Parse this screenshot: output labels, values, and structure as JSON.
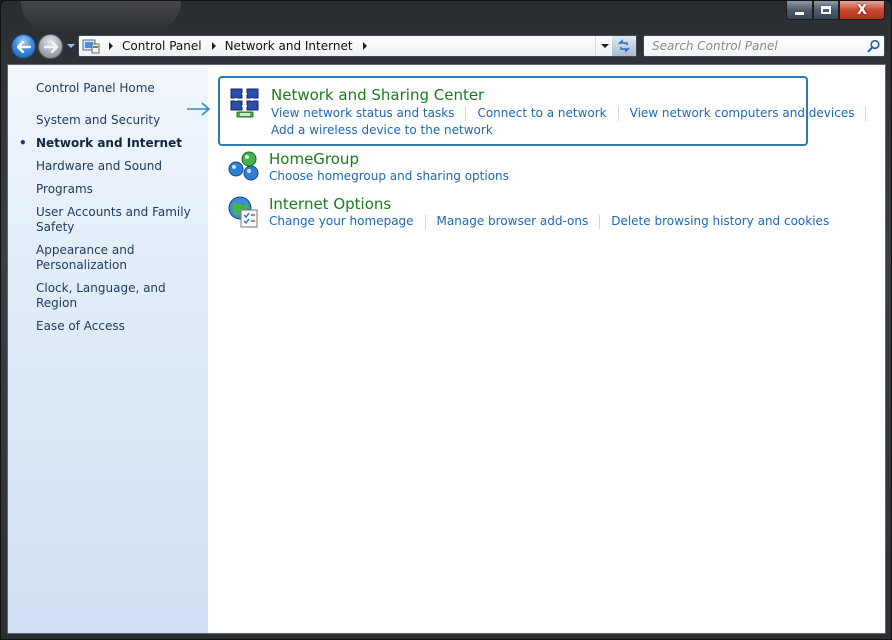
{
  "window": {
    "caption": {
      "minimize_icon": "minimize-icon",
      "maximize_icon": "maximize-icon",
      "close_icon": "close-icon",
      "close_glyph": "X"
    }
  },
  "nav": {
    "back_icon": "back-arrow-icon",
    "forward_icon": "forward-arrow-icon",
    "breadcrumbs": [
      "Control Panel",
      "Network and Internet"
    ],
    "search_placeholder": "Search Control Panel",
    "refresh_icon": "refresh-icon"
  },
  "sidebar": {
    "home": "Control Panel Home",
    "items": [
      {
        "label": "System and Security",
        "active": false
      },
      {
        "label": "Network and Internet",
        "active": true
      },
      {
        "label": "Hardware and Sound",
        "active": false
      },
      {
        "label": "Programs",
        "active": false
      },
      {
        "label": "User Accounts and Family Safety",
        "active": false
      },
      {
        "label": "Appearance and Personalization",
        "active": false
      },
      {
        "label": "Clock, Language, and Region",
        "active": false
      },
      {
        "label": "Ease of Access",
        "active": false
      }
    ]
  },
  "categories": [
    {
      "title": "Network and Sharing Center",
      "icon": "network-sharing-icon",
      "links": [
        "View network status and tasks",
        "Connect to a network",
        "View network computers and devices"
      ],
      "links_row2": [
        "Add a wireless device to the network"
      ],
      "selected": true
    },
    {
      "title": "HomeGroup",
      "icon": "homegroup-icon",
      "links": [
        "Choose homegroup and sharing options"
      ],
      "selected": false
    },
    {
      "title": "Internet Options",
      "icon": "internet-options-icon",
      "links": [
        "Change your homepage",
        "Manage browser add-ons",
        "Delete browsing history and cookies"
      ],
      "selected": false
    }
  ],
  "colors": {
    "link": "#1e68b5",
    "category_title": "#1b7c1b",
    "selection_border": "#2f7aa6"
  }
}
